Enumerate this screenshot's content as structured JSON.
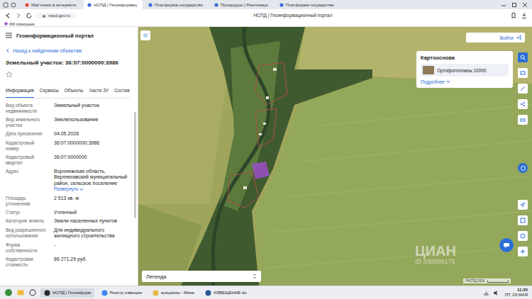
{
  "browser": {
    "tabs": [
      {
        "label": "Mail поиск в интернете",
        "selected": false
      },
      {
        "label": "НСПД | Геоинформац",
        "selected": true
      },
      {
        "label": "Платформа государстве",
        "selected": false
      },
      {
        "label": "Процедуры | Реализаци",
        "selected": false
      },
      {
        "label": "Платформа государстве",
        "selected": false
      }
    ],
    "address": "nspd.gov.ru",
    "page_title": "НСПД | Геоинформационный портал",
    "bookmarks": [
      "ИИ-помощник"
    ]
  },
  "panel": {
    "app_title": "Геоинформационный портал",
    "back": "Назад к найденным объектам",
    "title": "Земельный участок: 36:07:0000000:3986",
    "tabs": [
      {
        "label": "Информация",
        "selected": true
      },
      {
        "label": "Сервисы",
        "selected": false
      },
      {
        "label": "Объекты",
        "selected": false
      },
      {
        "label": "Части ЗУ",
        "selected": false
      },
      {
        "label": "Состав",
        "selected": false
      }
    ],
    "rows": [
      {
        "label": "Вид объекта недвижимости",
        "value": "Земельный участок"
      },
      {
        "label": "Вид земельного участка",
        "value": "Землепользование"
      },
      {
        "label": "Дата присвоения",
        "value": "04.05.2026"
      },
      {
        "label": "Кадастровый номер",
        "value": "36:07:0000000:3986"
      },
      {
        "label": "Кадастровый квартал",
        "value": "36:07:0000000"
      },
      {
        "label": "Адрес",
        "value": "Воронежская область, Верхнехавский муниципальный район, сельское поселение",
        "expand": "Развернуть"
      },
      {
        "label": "Площадь уточненная",
        "value": "2 513 кв. м"
      },
      {
        "label": "Статус",
        "value": "Учтенный"
      },
      {
        "label": "Категория земель",
        "value": "Земли населенных пунктов"
      },
      {
        "label": "Вид разрешенного использования",
        "value": "Для индивидуального жилищного строительства"
      },
      {
        "label": "Форма собственности",
        "value": "-"
      },
      {
        "label": "Кадастровая стоимость",
        "value": "86 271,29 руб."
      }
    ]
  },
  "map": {
    "login": "Войти",
    "basemap": {
      "title": "Картооснова",
      "layer": "Ортофотопланы 10000",
      "more": "Подробнее"
    },
    "legend": "Легенда",
    "watermark": {
      "brand": "ЦИАН",
      "id": "ID 330608175"
    },
    "attribution": "©НСПД 2026"
  },
  "taskbar": {
    "items": [
      {
        "label": "НСПД | Геоинформ",
        "selected": true
      },
      {
        "label": "Реестр извещен",
        "selected": false
      },
      {
        "label": "аукционы - Мене",
        "selected": false
      },
      {
        "label": "ИЗВЕЩЕНИЕ.do",
        "selected": false
      }
    ],
    "time": "11:35",
    "date": "ПТ, 29 МАЯ"
  }
}
